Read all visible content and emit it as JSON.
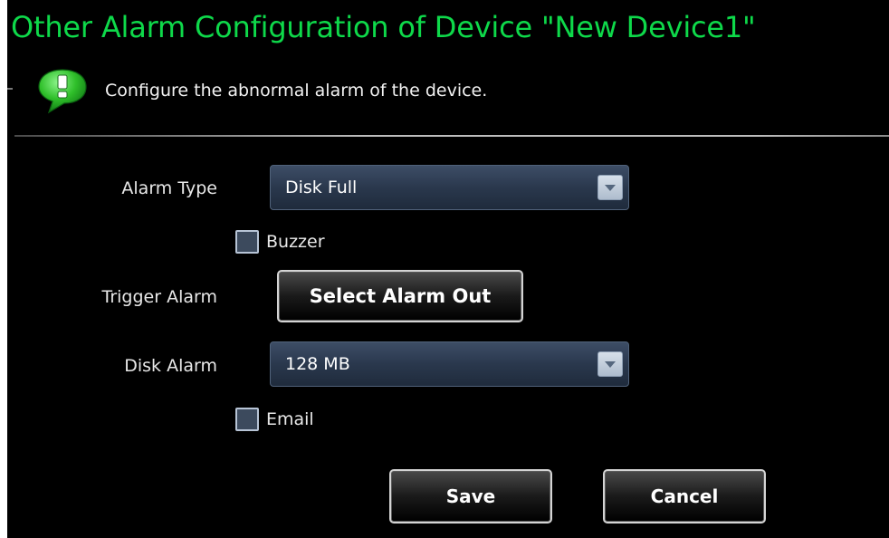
{
  "dialog": {
    "title": "Other Alarm Configuration of Device \"New Device1\"",
    "description": "Configure the abnormal alarm of the device.",
    "info_icon": "info-bubble-icon",
    "accent_color": "#0ed94a",
    "background_color": "#000000"
  },
  "form": {
    "alarm_type": {
      "label": "Alarm Type",
      "value": "Disk Full"
    },
    "buzzer": {
      "label": "Buzzer",
      "checked": false
    },
    "trigger_alarm": {
      "label": "Trigger Alarm",
      "button_label": "Select Alarm Out"
    },
    "disk_alarm": {
      "label": "Disk Alarm",
      "value": "128 MB"
    },
    "email": {
      "label": "Email",
      "checked": false
    }
  },
  "actions": {
    "save_label": "Save",
    "cancel_label": "Cancel"
  }
}
